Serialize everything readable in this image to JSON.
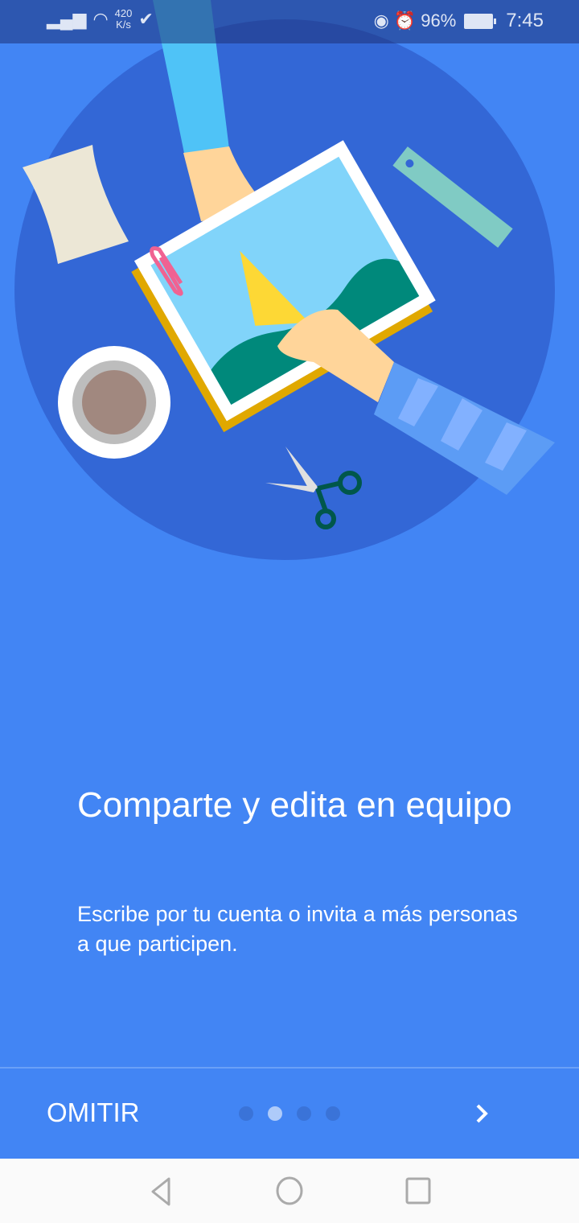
{
  "status_bar": {
    "network_speed_value": "420",
    "network_speed_unit": "K/s",
    "battery": "96%",
    "time": "7:45"
  },
  "onboarding": {
    "title": "Comparte y edita en equipo",
    "description": "Escribe por tu cuenta o invita a más personas a que participen.",
    "skip_label": "OMITIR",
    "page_count": 4,
    "current_page": 2
  },
  "colors": {
    "background": "#4285f4",
    "circle": "#3367d6",
    "dot_inactive": "#3a73d8",
    "dot_active": "#aecbfa"
  }
}
